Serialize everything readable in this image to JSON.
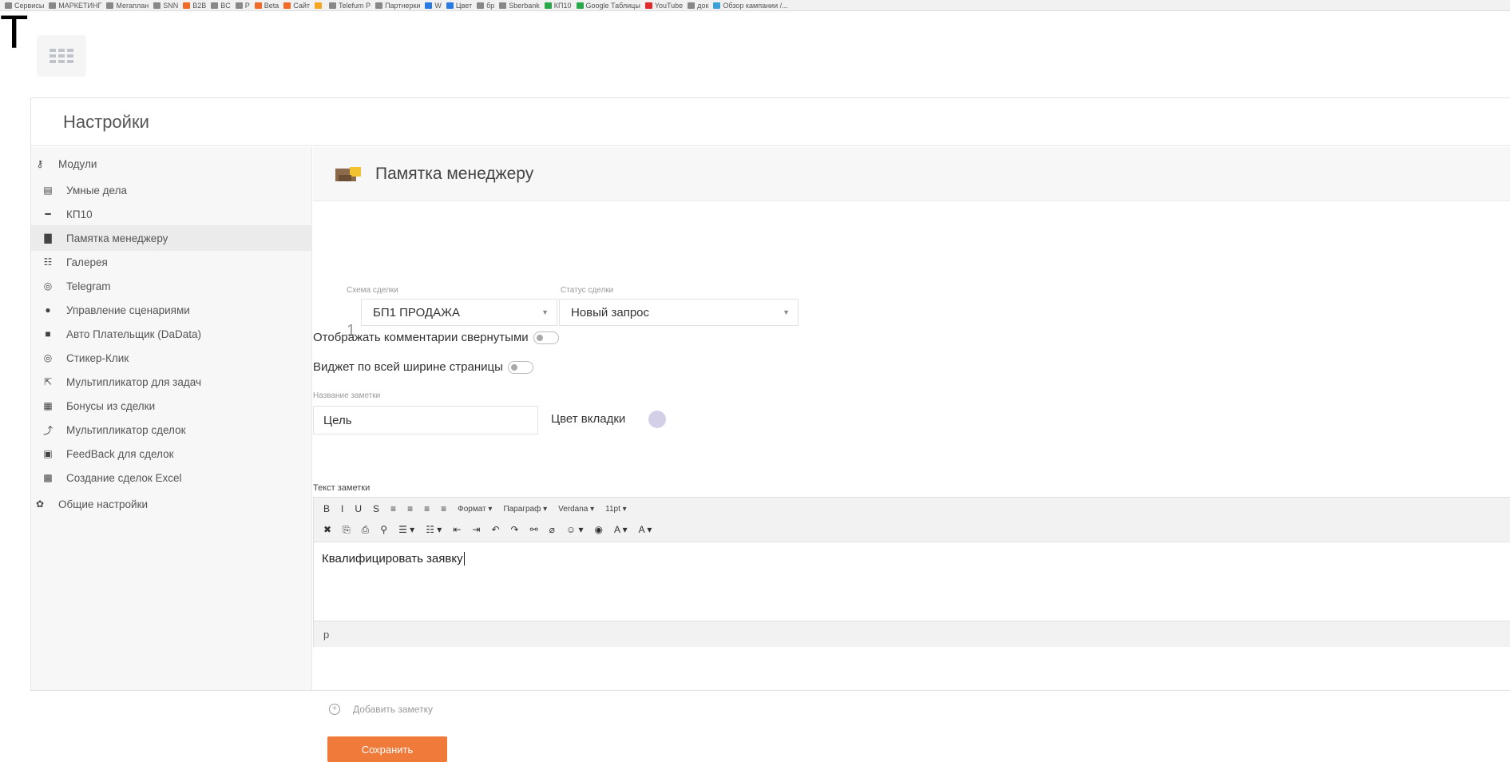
{
  "bookmarks": [
    {
      "label": "Сервисы",
      "color": "#888"
    },
    {
      "label": "МАРКЕТИНГ",
      "color": "#888"
    },
    {
      "label": "Мегаплан",
      "color": "#888"
    },
    {
      "label": "SNN",
      "color": "#888"
    },
    {
      "label": "B2B",
      "color": "#f06a2a"
    },
    {
      "label": "BC",
      "color": "#888"
    },
    {
      "label": "P",
      "color": "#888"
    },
    {
      "label": "Beta",
      "color": "#f06a2a"
    },
    {
      "label": "Сайт",
      "color": "#f06a2a"
    },
    {
      "label": "",
      "color": "#f5a623"
    },
    {
      "label": "Telefum P",
      "color": "#888"
    },
    {
      "label": "Партнерки",
      "color": "#888"
    },
    {
      "label": "W",
      "color": "#2a7ae2"
    },
    {
      "label": "Цвет",
      "color": "#2a7ae2"
    },
    {
      "label": "бр",
      "color": "#888"
    },
    {
      "label": "Sberbank",
      "color": "#888"
    },
    {
      "label": "КП10",
      "color": "#2aa84a"
    },
    {
      "label": "Google Таблицы",
      "color": "#2aa84a"
    },
    {
      "label": "YouTube",
      "color": "#e02a2a"
    },
    {
      "label": "док",
      "color": "#888"
    },
    {
      "label": "Обзор кампании /...",
      "color": "#3aa0d8"
    }
  ],
  "overlay_letter": "Т",
  "page_title": "Настройки",
  "sidebar": {
    "items": [
      {
        "label": "Модули",
        "icon": "key-icon",
        "glyph": "⚷"
      },
      {
        "label": "Умные дела",
        "icon": "bars-icon",
        "glyph": "▤"
      },
      {
        "label": "КП10",
        "icon": "dash-icon",
        "glyph": "━"
      },
      {
        "label": "Памятка менеджеру",
        "icon": "book-icon",
        "glyph": "▇"
      },
      {
        "label": "Галерея",
        "icon": "gallery-icon",
        "glyph": "☷"
      },
      {
        "label": "Telegram",
        "icon": "telegram-icon",
        "glyph": "◎"
      },
      {
        "label": "Управление сценариями",
        "icon": "circle-icon",
        "glyph": "●"
      },
      {
        "label": "Авто Плательщик (DaData)",
        "icon": "square-icon",
        "glyph": "■"
      },
      {
        "label": "Стикер-Клик",
        "icon": "check-circle-icon",
        "glyph": "◎"
      },
      {
        "label": "Мультипликатор для задач",
        "icon": "external-icon",
        "glyph": "⇱"
      },
      {
        "label": "Бонусы из сделки",
        "icon": "gift-icon",
        "glyph": "▦"
      },
      {
        "label": "Мультипликатор сделок",
        "icon": "link-icon",
        "glyph": "⤴"
      },
      {
        "label": "FeedBack для сделок",
        "icon": "chat-icon",
        "glyph": "▣"
      },
      {
        "label": "Создание сделок Excel",
        "icon": "excel-icon",
        "glyph": "▩"
      },
      {
        "label": "Общие настройки",
        "icon": "gear-icon",
        "glyph": "✿"
      }
    ]
  },
  "content": {
    "title": "Памятка менеджеру",
    "scheme_label": "Схема сделки",
    "status_label": "Статус сделки",
    "row_number": "1",
    "scheme_value": "БП1 ПРОДАЖА",
    "status_value": "Новый запрос",
    "toggle_collapsed_label": "Отображать комментарии свернутыми",
    "toggle_fullwidth_label": "Виджет по всей ширине страницы",
    "note_name_label": "Название заметки",
    "note_name_value": "Цель",
    "tab_color_label": "Цвет вкладки",
    "tab_color": "#d4cfe8",
    "note_text_label": "Текст заметки",
    "toolbar_row1": [
      "B",
      "I",
      "U",
      "S",
      "≡",
      "≡",
      "≡",
      "≡",
      "Формат ▾",
      "Параграф ▾",
      "Verdana ▾",
      "11pt ▾"
    ],
    "toolbar_row2": [
      "✖",
      "⎘",
      "⎙",
      "⚲",
      "☰ ▾",
      "☷ ▾",
      "⇤",
      "⇥",
      "↶",
      "↷",
      "⚯",
      "⌀",
      "☺ ▾",
      "◉",
      "A ▾",
      "A ▾"
    ],
    "editor_text": "Квалифицировать заявку",
    "editor_footer": "p",
    "add_note_label": "Добавить заметку",
    "save_label": "Сохранить"
  },
  "colors": {
    "accent": "#f07a3a",
    "sidebar_bg": "#f7f7f7"
  }
}
